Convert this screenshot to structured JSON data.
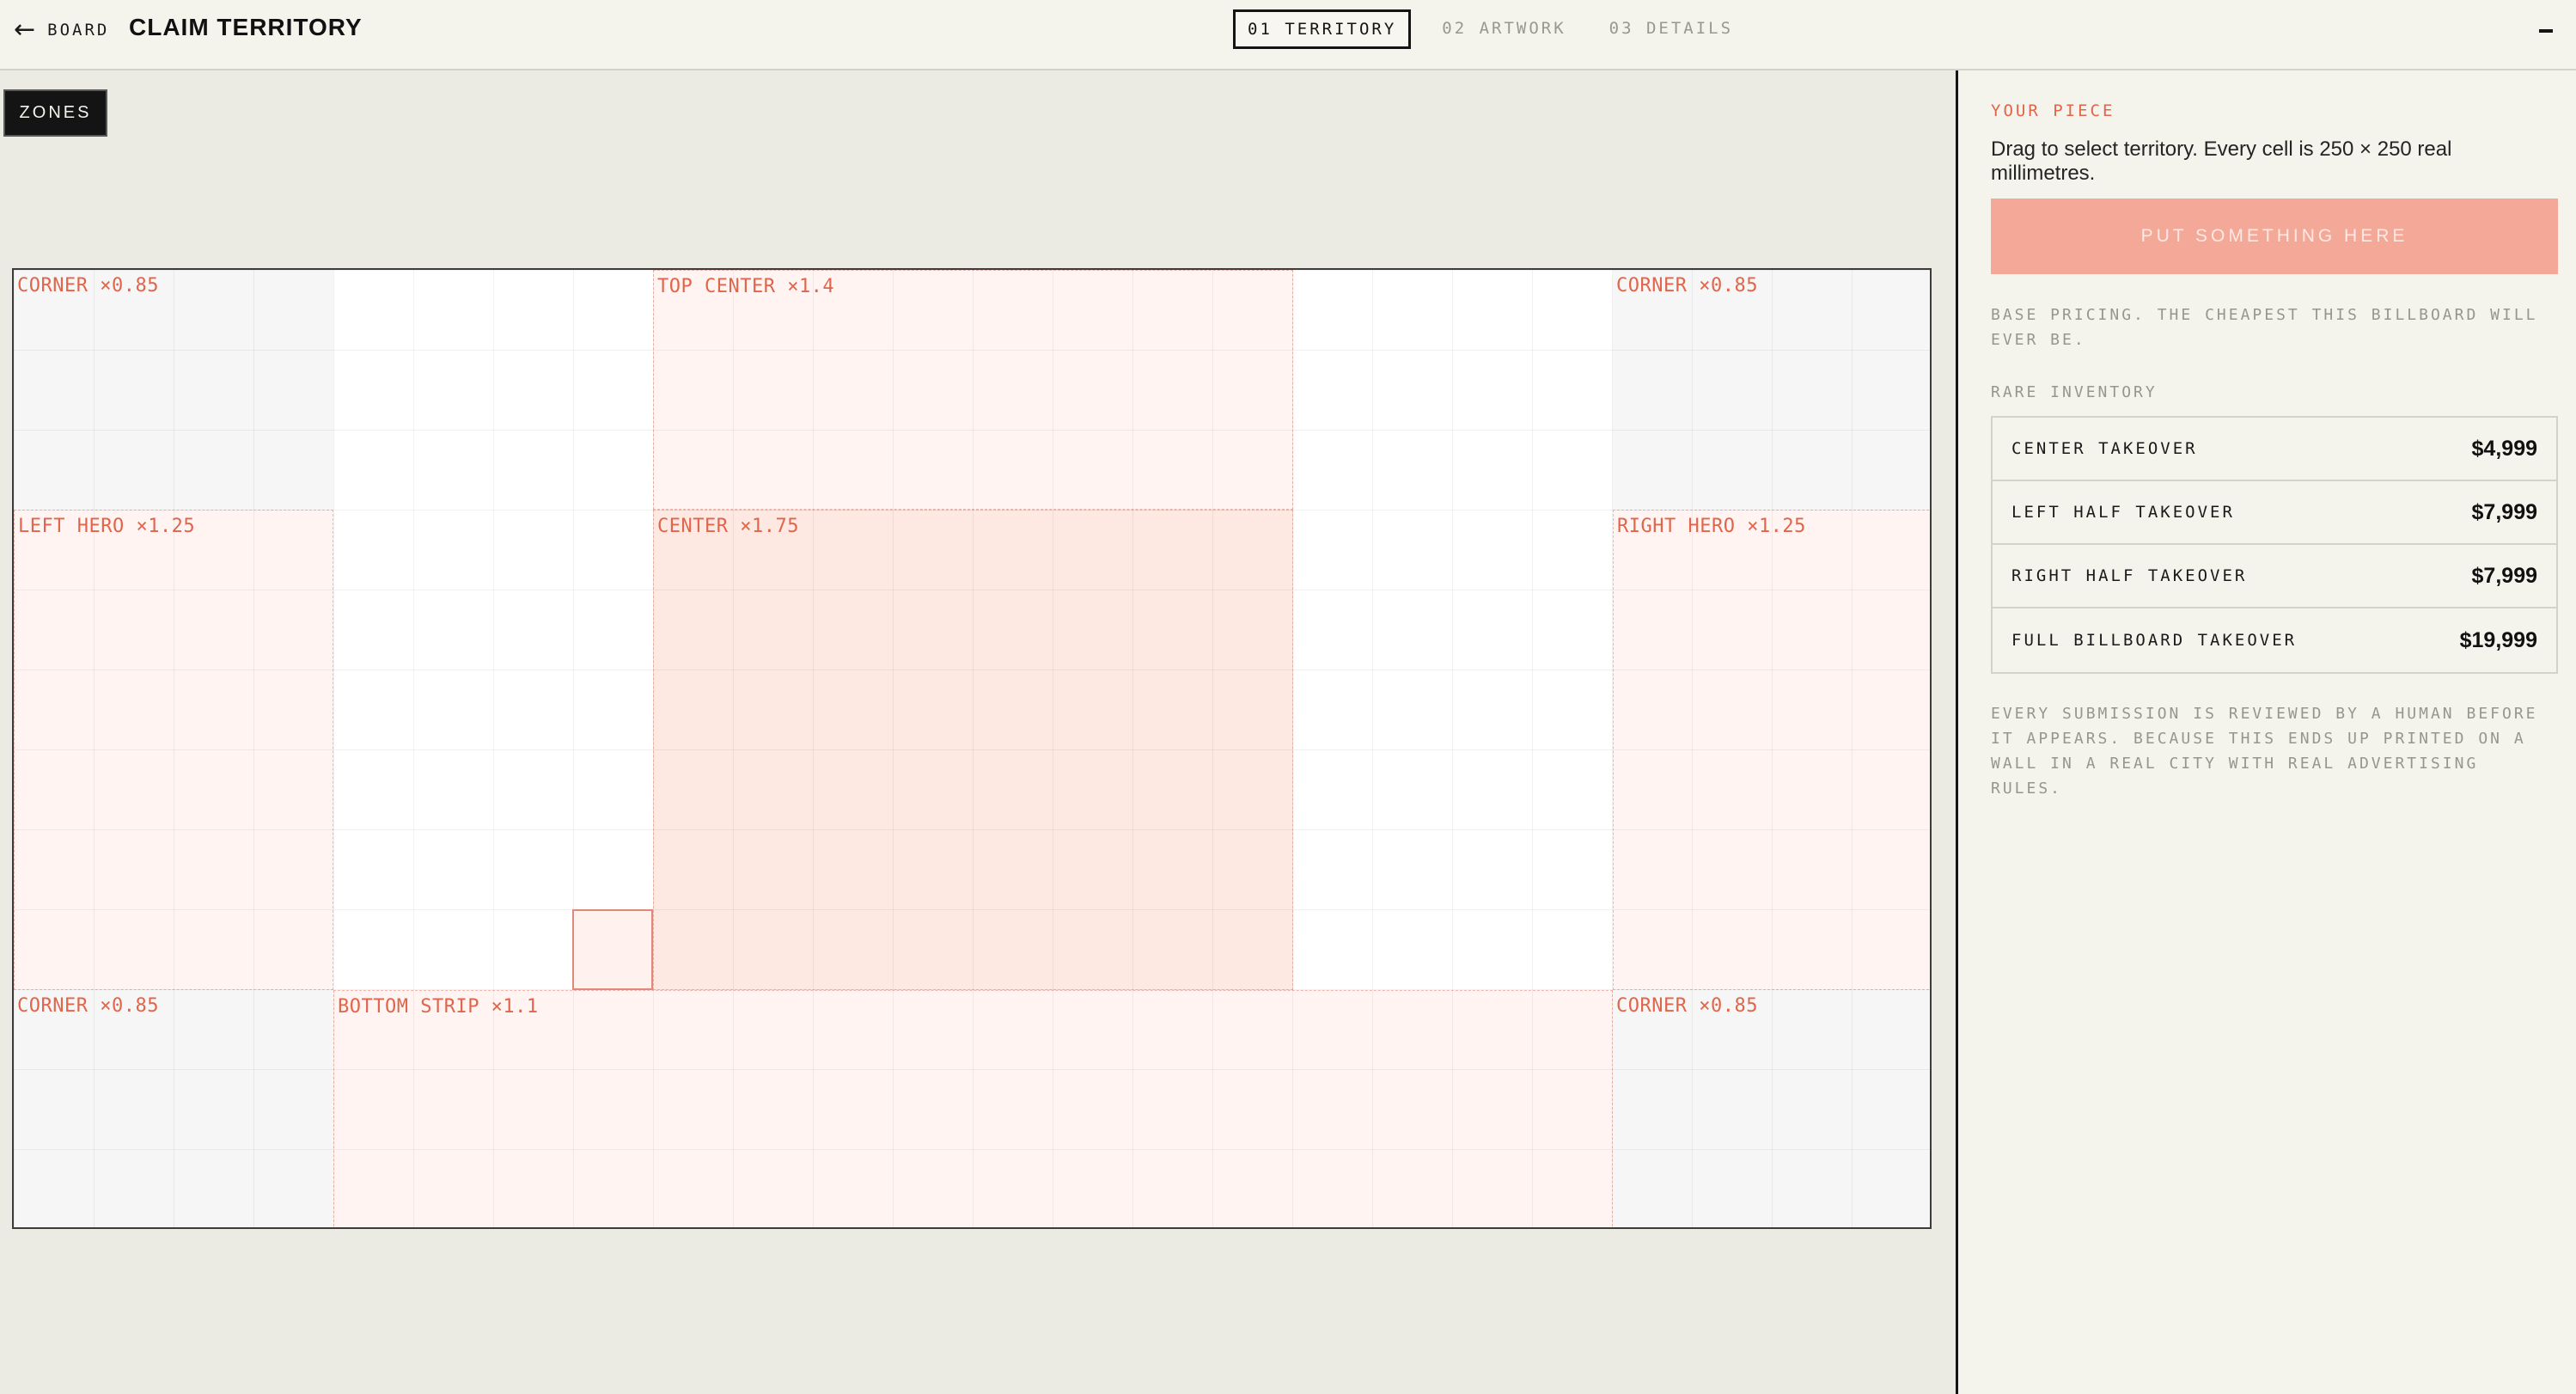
{
  "header": {
    "back_arrow": "←",
    "back_label": "BOARD",
    "title": "CLAIM TERRITORY",
    "steps": [
      {
        "label": "01 TERRITORY",
        "active": true
      },
      {
        "label": "02 ARTWORK",
        "active": false
      },
      {
        "label": "03 DETAILS",
        "active": false
      }
    ]
  },
  "toolbar": {
    "zones_label": "ZONES"
  },
  "board": {
    "zones": {
      "corner_tl": "CORNER ×0.85",
      "top_center": "TOP CENTER ×1.4",
      "corner_tr": "CORNER ×0.85",
      "left_hero": "LEFT HERO ×1.25",
      "center": "CENTER ×1.75",
      "right_hero": "RIGHT HERO ×1.25",
      "corner_bl": "CORNER ×0.85",
      "bottom_strip": "BOTTOM STRIP ×1.1",
      "corner_br": "CORNER ×0.85"
    }
  },
  "panel": {
    "eyebrow": "YOUR PIECE",
    "description": "Drag to select territory. Every cell is 250 × 250 real millimetres.",
    "cta_label": "PUT SOMETHING HERE",
    "pricing_note": "BASE PRICING. THE CHEAPEST THIS BILLBOARD WILL EVER BE.",
    "rare_label": "RARE INVENTORY",
    "inventory": [
      {
        "name": "CENTER TAKEOVER",
        "price": "$4,999"
      },
      {
        "name": "LEFT HALF TAKEOVER",
        "price": "$7,999"
      },
      {
        "name": "RIGHT HALF TAKEOVER",
        "price": "$7,999"
      },
      {
        "name": "FULL BILLBOARD TAKEOVER",
        "price": "$19,999"
      }
    ],
    "review_note": "EVERY SUBMISSION IS REVIEWED BY A HUMAN BEFORE IT APPEARS. BECAUSE THIS ENDS UP PRINTED ON A WALL IN A REAL CITY WITH REAL ADVERTISING RULES."
  },
  "colors": {
    "accent": "#e0654a",
    "cta_bg": "#f4a998",
    "ink": "#141414",
    "paper": "#f4f3ec"
  }
}
